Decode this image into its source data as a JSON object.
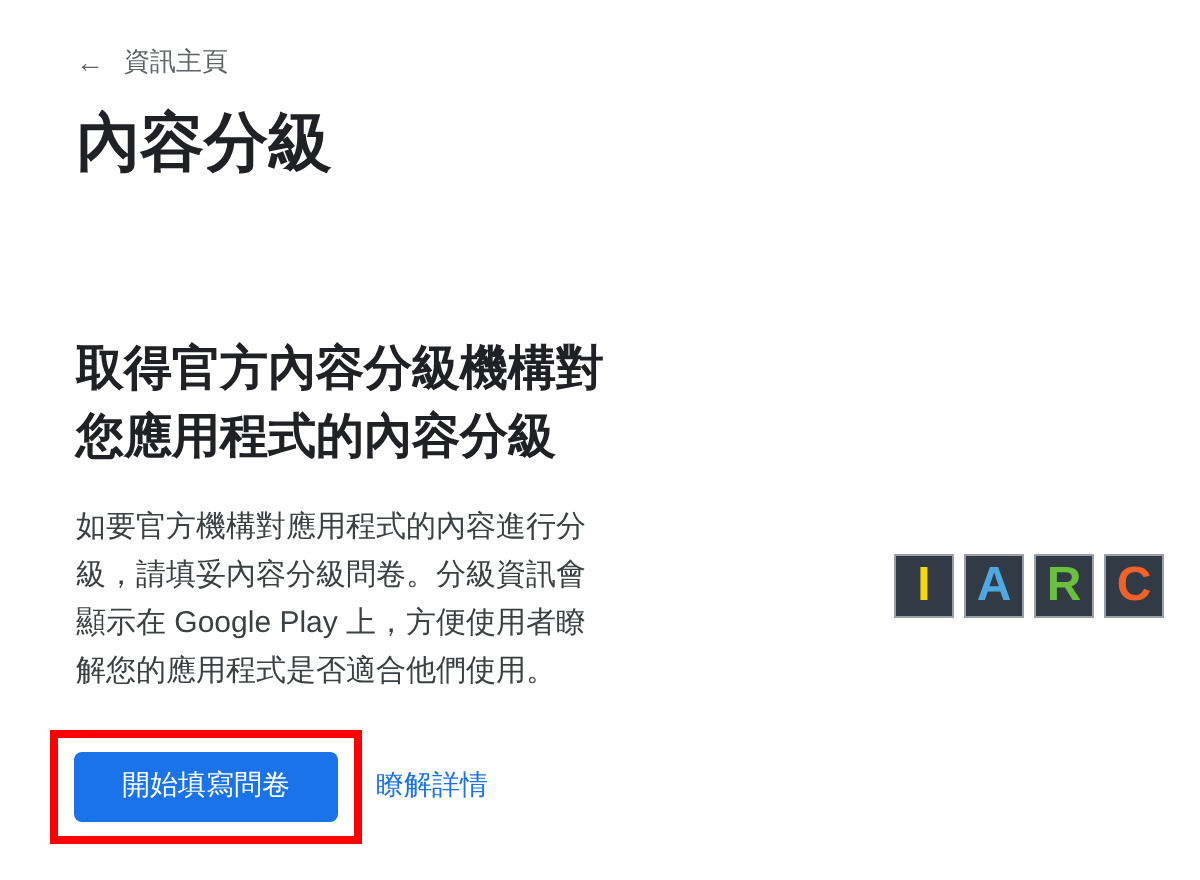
{
  "back_link": {
    "icon": "←",
    "label": "資訊主頁"
  },
  "title": "內容分級",
  "heading": "取得官方內容分級機構對您應用程式的內容分級",
  "description": "如要官方機構對應用程式的內容進行分級，請填妥內容分級問卷。分級資訊會顯示在 Google Play 上，方便使用者瞭解您的應用程式是否適合他們使用。",
  "primary_button": {
    "label": "開始填寫問卷",
    "highlighted": true
  },
  "learn_more_link": "瞭解詳情",
  "logo_letters": [
    {
      "letter": "I",
      "color": "#f5d90a"
    },
    {
      "letter": "A",
      "color": "#4fa8e0"
    },
    {
      "letter": "R",
      "color": "#6abf3f"
    },
    {
      "letter": "C",
      "color": "#f0622a"
    }
  ]
}
